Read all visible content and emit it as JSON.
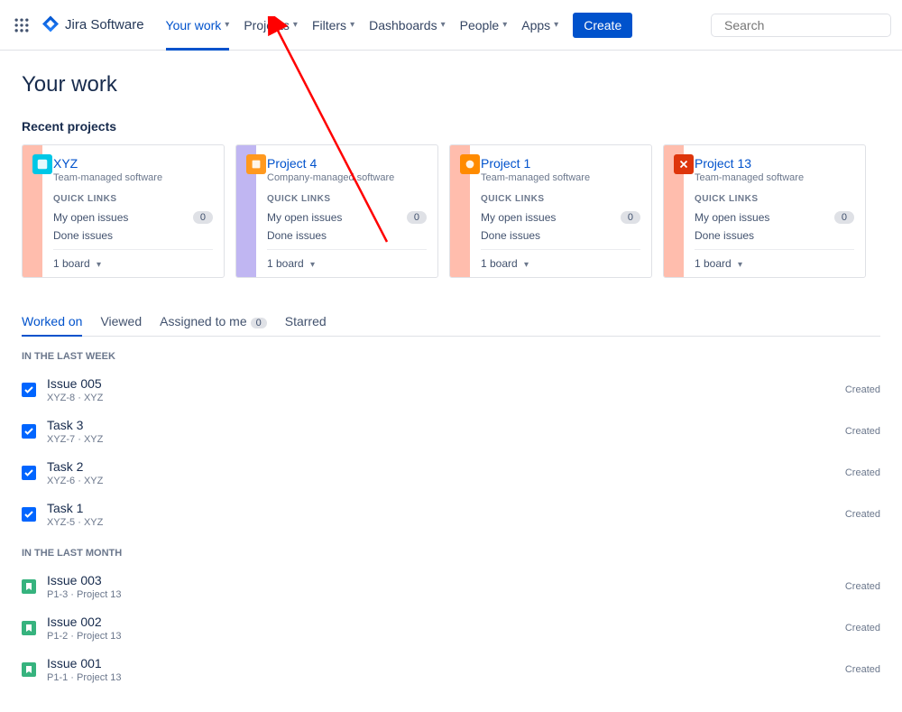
{
  "nav": {
    "logo_text": "Jira Software",
    "items": [
      "Your work",
      "Projects",
      "Filters",
      "Dashboards",
      "People",
      "Apps"
    ],
    "create": "Create"
  },
  "search": {
    "placeholder": "Search"
  },
  "page_title": "Your work",
  "recents_title": "Recent projects",
  "projects": [
    {
      "name": "XYZ",
      "type": "Team-managed software",
      "open_issues": "0",
      "board": "1 board"
    },
    {
      "name": "Project 4",
      "type": "Company-managed software",
      "open_issues": "0",
      "board": "1 board"
    },
    {
      "name": "Project 1",
      "type": "Team-managed software",
      "open_issues": "0",
      "board": "1 board"
    },
    {
      "name": "Project 13",
      "type": "Team-managed software",
      "open_issues": "0",
      "board": "1 board"
    }
  ],
  "quick_links_label": "QUICK LINKS",
  "my_open_issues": "My open issues",
  "done_issues": "Done issues",
  "tabs": {
    "worked_on": "Worked on",
    "viewed": "Viewed",
    "assigned": "Assigned to me",
    "assigned_count": "0",
    "starred": "Starred"
  },
  "periods": {
    "last_week": "IN THE LAST WEEK",
    "last_month": "IN THE LAST MONTH"
  },
  "issues_week": [
    {
      "title": "Issue 005",
      "key": "XYZ-8",
      "proj": "XYZ",
      "status": "Created",
      "type": "task"
    },
    {
      "title": "Task 3",
      "key": "XYZ-7",
      "proj": "XYZ",
      "status": "Created",
      "type": "task"
    },
    {
      "title": "Task 2",
      "key": "XYZ-6",
      "proj": "XYZ",
      "status": "Created",
      "type": "task"
    },
    {
      "title": "Task 1",
      "key": "XYZ-5",
      "proj": "XYZ",
      "status": "Created",
      "type": "task"
    }
  ],
  "issues_month": [
    {
      "title": "Issue 003",
      "key": "P1-3",
      "proj": "Project 13",
      "status": "Created",
      "type": "story"
    },
    {
      "title": "Issue 002",
      "key": "P1-2",
      "proj": "Project 13",
      "status": "Created",
      "type": "story"
    },
    {
      "title": "Issue 001",
      "key": "P1-1",
      "proj": "Project 13",
      "status": "Created",
      "type": "story"
    }
  ]
}
